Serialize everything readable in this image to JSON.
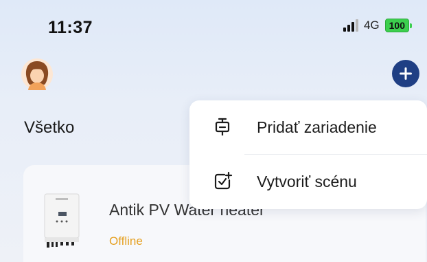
{
  "status_bar": {
    "time": "11:37",
    "network": "4G",
    "battery": "100",
    "battery_color": "#3ccf4e"
  },
  "header": {
    "avatar_icon": "user-avatar-icon",
    "add_icon": "plus-icon",
    "accent_color": "#1f3f84"
  },
  "section": {
    "title": "Všetko"
  },
  "device": {
    "name": "Antik PV Water heater",
    "status": "Offline",
    "status_color": "#e5a021"
  },
  "menu": {
    "items": [
      {
        "label": "Pridať zariadenie",
        "icon": "add-device-icon"
      },
      {
        "label": "Vytvoriť scénu",
        "icon": "create-scene-icon"
      }
    ]
  }
}
